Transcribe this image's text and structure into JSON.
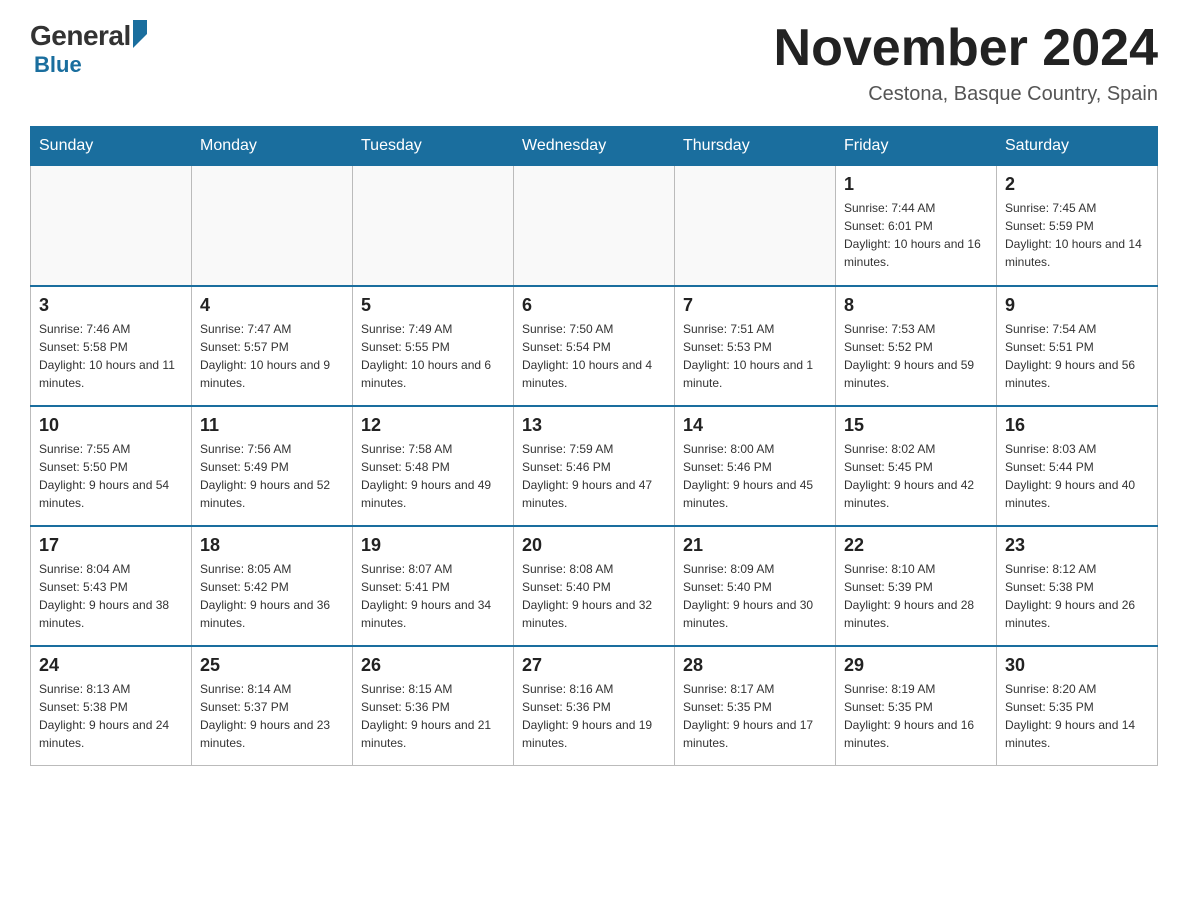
{
  "header": {
    "logo": {
      "general": "General",
      "blue": "Blue"
    },
    "title": "November 2024",
    "location": "Cestona, Basque Country, Spain"
  },
  "days_of_week": [
    "Sunday",
    "Monday",
    "Tuesday",
    "Wednesday",
    "Thursday",
    "Friday",
    "Saturday"
  ],
  "weeks": [
    [
      {
        "day": "",
        "info": ""
      },
      {
        "day": "",
        "info": ""
      },
      {
        "day": "",
        "info": ""
      },
      {
        "day": "",
        "info": ""
      },
      {
        "day": "",
        "info": ""
      },
      {
        "day": "1",
        "info": "Sunrise: 7:44 AM\nSunset: 6:01 PM\nDaylight: 10 hours and 16 minutes."
      },
      {
        "day": "2",
        "info": "Sunrise: 7:45 AM\nSunset: 5:59 PM\nDaylight: 10 hours and 14 minutes."
      }
    ],
    [
      {
        "day": "3",
        "info": "Sunrise: 7:46 AM\nSunset: 5:58 PM\nDaylight: 10 hours and 11 minutes."
      },
      {
        "day": "4",
        "info": "Sunrise: 7:47 AM\nSunset: 5:57 PM\nDaylight: 10 hours and 9 minutes."
      },
      {
        "day": "5",
        "info": "Sunrise: 7:49 AM\nSunset: 5:55 PM\nDaylight: 10 hours and 6 minutes."
      },
      {
        "day": "6",
        "info": "Sunrise: 7:50 AM\nSunset: 5:54 PM\nDaylight: 10 hours and 4 minutes."
      },
      {
        "day": "7",
        "info": "Sunrise: 7:51 AM\nSunset: 5:53 PM\nDaylight: 10 hours and 1 minute."
      },
      {
        "day": "8",
        "info": "Sunrise: 7:53 AM\nSunset: 5:52 PM\nDaylight: 9 hours and 59 minutes."
      },
      {
        "day": "9",
        "info": "Sunrise: 7:54 AM\nSunset: 5:51 PM\nDaylight: 9 hours and 56 minutes."
      }
    ],
    [
      {
        "day": "10",
        "info": "Sunrise: 7:55 AM\nSunset: 5:50 PM\nDaylight: 9 hours and 54 minutes."
      },
      {
        "day": "11",
        "info": "Sunrise: 7:56 AM\nSunset: 5:49 PM\nDaylight: 9 hours and 52 minutes."
      },
      {
        "day": "12",
        "info": "Sunrise: 7:58 AM\nSunset: 5:48 PM\nDaylight: 9 hours and 49 minutes."
      },
      {
        "day": "13",
        "info": "Sunrise: 7:59 AM\nSunset: 5:46 PM\nDaylight: 9 hours and 47 minutes."
      },
      {
        "day": "14",
        "info": "Sunrise: 8:00 AM\nSunset: 5:46 PM\nDaylight: 9 hours and 45 minutes."
      },
      {
        "day": "15",
        "info": "Sunrise: 8:02 AM\nSunset: 5:45 PM\nDaylight: 9 hours and 42 minutes."
      },
      {
        "day": "16",
        "info": "Sunrise: 8:03 AM\nSunset: 5:44 PM\nDaylight: 9 hours and 40 minutes."
      }
    ],
    [
      {
        "day": "17",
        "info": "Sunrise: 8:04 AM\nSunset: 5:43 PM\nDaylight: 9 hours and 38 minutes."
      },
      {
        "day": "18",
        "info": "Sunrise: 8:05 AM\nSunset: 5:42 PM\nDaylight: 9 hours and 36 minutes."
      },
      {
        "day": "19",
        "info": "Sunrise: 8:07 AM\nSunset: 5:41 PM\nDaylight: 9 hours and 34 minutes."
      },
      {
        "day": "20",
        "info": "Sunrise: 8:08 AM\nSunset: 5:40 PM\nDaylight: 9 hours and 32 minutes."
      },
      {
        "day": "21",
        "info": "Sunrise: 8:09 AM\nSunset: 5:40 PM\nDaylight: 9 hours and 30 minutes."
      },
      {
        "day": "22",
        "info": "Sunrise: 8:10 AM\nSunset: 5:39 PM\nDaylight: 9 hours and 28 minutes."
      },
      {
        "day": "23",
        "info": "Sunrise: 8:12 AM\nSunset: 5:38 PM\nDaylight: 9 hours and 26 minutes."
      }
    ],
    [
      {
        "day": "24",
        "info": "Sunrise: 8:13 AM\nSunset: 5:38 PM\nDaylight: 9 hours and 24 minutes."
      },
      {
        "day": "25",
        "info": "Sunrise: 8:14 AM\nSunset: 5:37 PM\nDaylight: 9 hours and 23 minutes."
      },
      {
        "day": "26",
        "info": "Sunrise: 8:15 AM\nSunset: 5:36 PM\nDaylight: 9 hours and 21 minutes."
      },
      {
        "day": "27",
        "info": "Sunrise: 8:16 AM\nSunset: 5:36 PM\nDaylight: 9 hours and 19 minutes."
      },
      {
        "day": "28",
        "info": "Sunrise: 8:17 AM\nSunset: 5:35 PM\nDaylight: 9 hours and 17 minutes."
      },
      {
        "day": "29",
        "info": "Sunrise: 8:19 AM\nSunset: 5:35 PM\nDaylight: 9 hours and 16 minutes."
      },
      {
        "day": "30",
        "info": "Sunrise: 8:20 AM\nSunset: 5:35 PM\nDaylight: 9 hours and 14 minutes."
      }
    ]
  ]
}
